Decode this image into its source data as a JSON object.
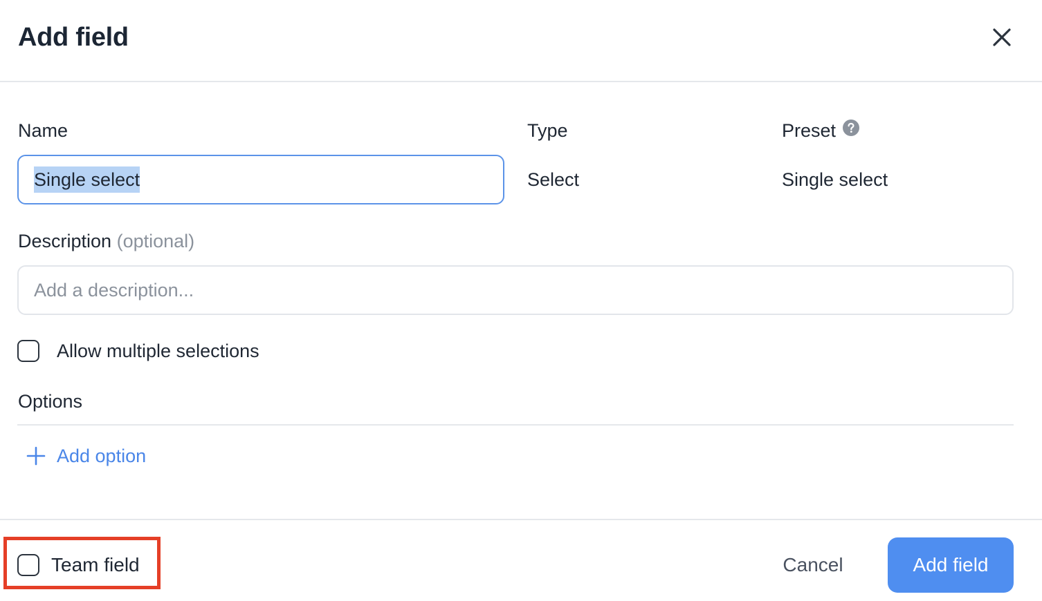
{
  "dialog": {
    "title": "Add field",
    "close_icon": "close-icon"
  },
  "form": {
    "name_label": "Name",
    "name_value": "Single select",
    "type_label": "Type",
    "type_value": "Select",
    "preset_label": "Preset",
    "preset_value": "Single select",
    "help_icon": "question-circle-icon",
    "description_label": "Description",
    "description_optional": "(optional)",
    "description_placeholder": "Add a description...",
    "description_value": "",
    "allow_multiple_label": "Allow multiple selections",
    "allow_multiple_checked": false,
    "options_label": "Options",
    "add_option_label": "Add option",
    "add_option_icon": "plus-icon"
  },
  "footer": {
    "team_field_label": "Team field",
    "team_field_checked": false,
    "cancel_label": "Cancel",
    "submit_label": "Add field"
  },
  "colors": {
    "accent": "#4f8ef0",
    "link": "#4a86e8",
    "focus_border": "#5b93e8",
    "selection": "#b7d3f5",
    "highlight_box": "#e53f27"
  }
}
